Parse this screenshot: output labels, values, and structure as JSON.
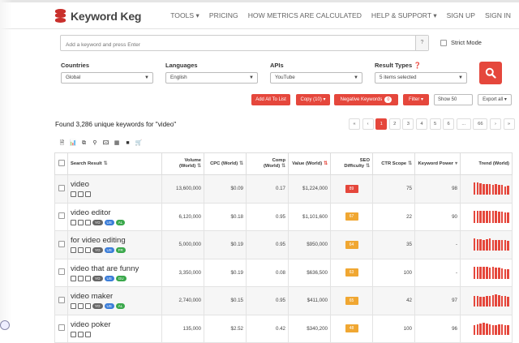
{
  "brand": "Keyword Keg",
  "nav": [
    "TOOLS ▾",
    "PRICING",
    "HOW METRICS ARE CALCULATED",
    "HELP & SUPPORT ▾",
    "SIGN UP",
    "SIGN IN"
  ],
  "search": {
    "placeholder": "Add a keyword and press Enter",
    "help": "?"
  },
  "strict_mode": "Strict Mode",
  "filters": {
    "countries_label": "Countries",
    "countries_value": "Global",
    "languages_label": "Languages",
    "languages_value": "English",
    "apis_label": "APIs",
    "apis_value": "YouTube",
    "result_types_label": "Result Types",
    "result_types_value": "5 items selected"
  },
  "actions": {
    "add_all": "Add All To List",
    "copy": "Copy (10) ▾",
    "negative": "Negative Keywords",
    "negative_count": "0",
    "filter": "Filter ▾",
    "show": "Show 50",
    "export": "Export all ▾"
  },
  "found_text": "Found 3,286 unique keywords for \"video\"",
  "pagination": [
    "«",
    "‹",
    "1",
    "2",
    "3",
    "4",
    "5",
    "6",
    "...",
    "66",
    "›",
    "»"
  ],
  "pagination_active": "1",
  "headers": {
    "search": "Search Result",
    "volume": "Volume (World)",
    "cpc": "CPC (World)",
    "comp": "Comp (World)",
    "value": "Value (World)",
    "seo": "SEO Difficulty",
    "ctr": "CTR Scope",
    "power": "Keyword Power",
    "trend": "Trend (World)"
  },
  "rows": [
    {
      "keyword": "video",
      "volume": "13,600,000",
      "cpc": "$0.09",
      "comp": "0.17",
      "value": "$1,224,000",
      "seo": "89",
      "seo_color": "#e5473c",
      "ctr": "75",
      "power": "98",
      "tags": [],
      "trend": [
        1,
        1,
        0.95,
        0.9,
        0.85,
        0.9,
        0.8,
        0.85,
        0.8,
        0.8,
        0.7,
        0.75
      ]
    },
    {
      "keyword": "video editor",
      "volume": "6,120,000",
      "cpc": "$0.18",
      "comp": "0.95",
      "value": "$1,101,600",
      "seo": "67",
      "seo_color": "#f0a732",
      "ctr": "22",
      "power": "90",
      "tags": [
        "YO",
        "US",
        "AL"
      ],
      "trend": [
        1,
        1,
        1,
        0.95,
        1,
        0.95,
        0.95,
        0.95,
        0.9,
        0.9,
        0.85,
        0.85
      ]
    },
    {
      "keyword": "for video editing",
      "volume": "5,000,000",
      "cpc": "$0.19",
      "comp": "0.95",
      "value": "$950,000",
      "seo": "64",
      "seo_color": "#f0a732",
      "ctr": "35",
      "power": "-",
      "tags": [
        "YO",
        "US",
        "FR"
      ],
      "trend": [
        1,
        0.95,
        0.95,
        0.9,
        0.95,
        1,
        0.9,
        0.9,
        0.9,
        0.85,
        0.85,
        0.8
      ]
    },
    {
      "keyword": "video that are funny",
      "volume": "3,350,000",
      "cpc": "$0.19",
      "comp": "0.08",
      "value": "$636,500",
      "seo": "63",
      "seo_color": "#f0a732",
      "ctr": "100",
      "power": "-",
      "tags": [
        "YO",
        "US",
        "GU"
      ],
      "trend": [
        1,
        1,
        1,
        0.95,
        0.95,
        0.9,
        0.95,
        0.9,
        0.9,
        0.85,
        0.8,
        0.8
      ]
    },
    {
      "keyword": "video maker",
      "volume": "2,740,000",
      "cpc": "$0.15",
      "comp": "0.95",
      "value": "$411,000",
      "seo": "65",
      "seo_color": "#f0a732",
      "ctr": "42",
      "power": "97",
      "tags": [
        "YO",
        "US",
        "AL"
      ],
      "trend": [
        0.9,
        0.85,
        0.8,
        0.8,
        0.85,
        0.9,
        0.95,
        1,
        0.95,
        0.9,
        0.85,
        0.8
      ]
    },
    {
      "keyword": "video poker",
      "volume": "135,000",
      "cpc": "$2.52",
      "comp": "0.42",
      "value": "$340,200",
      "seo": "48",
      "seo_color": "#f0a732",
      "ctr": "100",
      "power": "96",
      "tags": [],
      "trend": [
        0.8,
        0.85,
        0.9,
        0.95,
        0.9,
        0.85,
        0.8,
        0.8,
        0.85,
        0.85,
        0.8,
        0.8
      ]
    }
  ]
}
